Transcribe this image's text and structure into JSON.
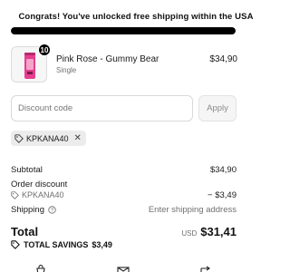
{
  "shipping_banner": {
    "message": "Congrats! You've unlocked free shipping within the USA",
    "progress_fraction": 1.0
  },
  "cart_item": {
    "quantity": "10",
    "name": "Pink Rose - Gummy Bear",
    "variant": "Single",
    "price": "$34,90",
    "thumbnail_icon": "product-can-icon"
  },
  "discount": {
    "placeholder": "Discount code",
    "apply_label": "Apply",
    "applied_code": "KPKANA40",
    "tag_icon": "tag-icon",
    "remove_icon": "close-icon"
  },
  "summary": {
    "subtotal_label": "Subtotal",
    "subtotal_value": "$34,90",
    "order_discount_label": "Order discount",
    "discount_code": "KPKANA40",
    "discount_value": "− $3,49",
    "shipping_label": "Shipping",
    "shipping_value": "Enter shipping address",
    "help_icon": "question-circle-icon"
  },
  "total": {
    "label": "Total",
    "currency": "USD",
    "value": "$31,41"
  },
  "savings": {
    "label": "TOTAL SAVINGS",
    "value": "$3,49"
  },
  "colors": {
    "accent": "#000000",
    "track": "#e5e5e5",
    "product_pink": "#e63d8f"
  }
}
